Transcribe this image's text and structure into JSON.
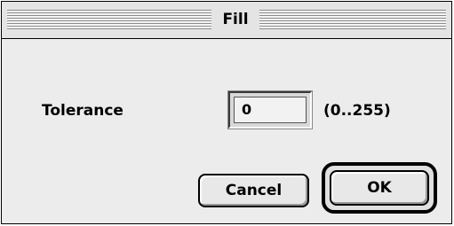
{
  "window": {
    "title": "Fill"
  },
  "form": {
    "tolerance_label": "Tolerance",
    "tolerance_value": "0",
    "range_hint": "(0..255)"
  },
  "buttons": {
    "cancel_label": "Cancel",
    "ok_label": "OK"
  }
}
